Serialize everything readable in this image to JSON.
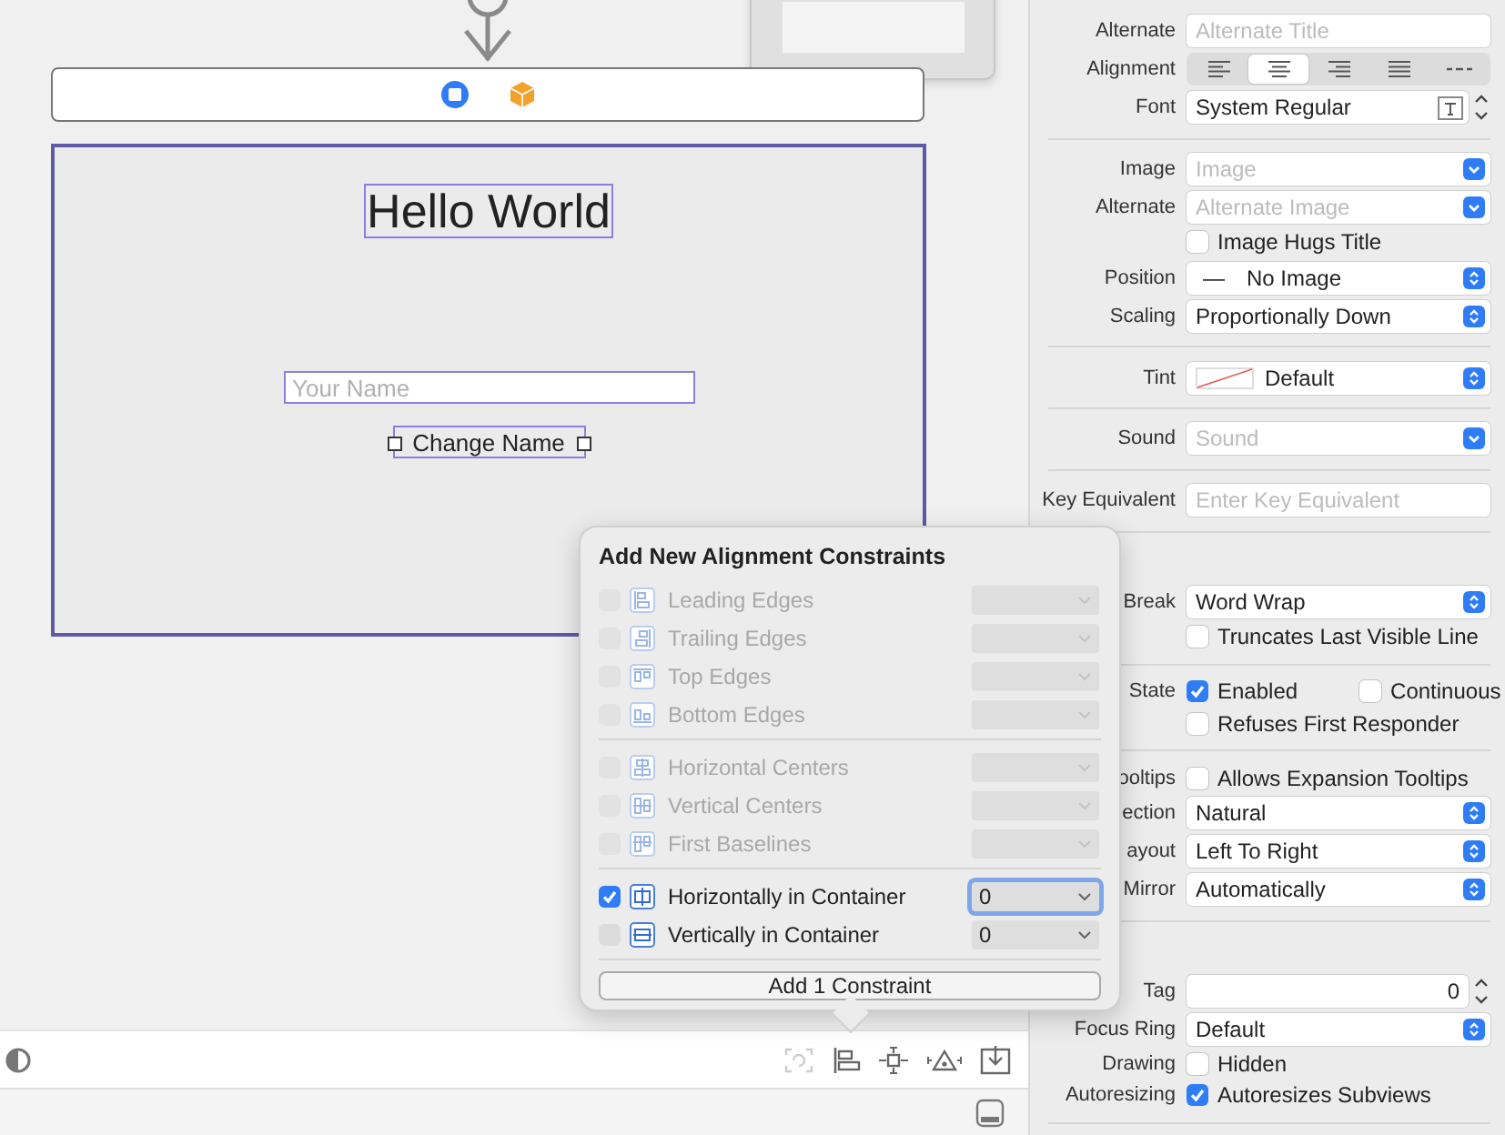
{
  "canvas": {
    "title": "Hello World",
    "text_field": {
      "placeholder": "Your Name"
    },
    "button": "Change Name"
  },
  "popover": {
    "title": "Add New Alignment Constraints",
    "groups": [
      [
        {
          "kind": "leading",
          "label": "Leading Edges",
          "checked": false,
          "disabled": true
        },
        {
          "kind": "trailing",
          "label": "Trailing Edges",
          "checked": false,
          "disabled": true
        },
        {
          "kind": "top",
          "label": "Top Edges",
          "checked": false,
          "disabled": true
        },
        {
          "kind": "bottom",
          "label": "Bottom Edges",
          "checked": false,
          "disabled": true
        }
      ],
      [
        {
          "kind": "hcenter",
          "label": "Horizontal Centers",
          "checked": false,
          "disabled": true
        },
        {
          "kind": "vcenter",
          "label": "Vertical Centers",
          "checked": false,
          "disabled": true
        },
        {
          "kind": "baseline",
          "label": "First Baselines",
          "checked": false,
          "disabled": true
        }
      ],
      [
        {
          "kind": "hcontainer",
          "label": "Horizontally in Container",
          "checked": true,
          "disabled": false,
          "value": "0",
          "focused": true
        },
        {
          "kind": "vcontainer",
          "label": "Vertically in Container",
          "checked": false,
          "disabled": false,
          "value": "0",
          "focused": false
        }
      ]
    ],
    "button": "Add 1 Constraint"
  },
  "inspector": [
    {
      "kind": "field",
      "label": "Alternate",
      "placeholder": "Alternate Title"
    },
    {
      "kind": "segmented",
      "label": "Alignment",
      "segments": [
        {
          "kind": "left",
          "selected": false
        },
        {
          "kind": "center",
          "selected": true
        },
        {
          "kind": "right",
          "selected": false
        },
        {
          "kind": "justify",
          "selected": false
        },
        {
          "kind": "natural",
          "selected": false
        }
      ]
    },
    {
      "kind": "font",
      "label": "Font",
      "value": "System Regular"
    },
    {
      "kind": "divider"
    },
    {
      "kind": "combo",
      "label": "Image",
      "placeholder": "Image"
    },
    {
      "kind": "combo",
      "label": "Alternate",
      "placeholder": "Alternate Image"
    },
    {
      "kind": "checks",
      "checks": [
        {
          "label": "Image Hugs Title",
          "checked": false
        }
      ]
    },
    {
      "kind": "popup",
      "label": "Position",
      "value": "No Image",
      "prefix": "—"
    },
    {
      "kind": "popup",
      "label": "Scaling",
      "value": "Proportionally Down"
    },
    {
      "kind": "divider"
    },
    {
      "kind": "popup",
      "label": "Tint",
      "value": "Default",
      "swatch": true
    },
    {
      "kind": "divider"
    },
    {
      "kind": "combo",
      "label": "Sound",
      "placeholder": "Sound"
    },
    {
      "kind": "divider"
    },
    {
      "kind": "field",
      "label": "Key Equivalent",
      "placeholder": "Enter Key Equivalent"
    },
    {
      "kind": "divider"
    },
    {
      "kind": "spacer"
    },
    {
      "kind": "popup",
      "label": "Break",
      "value": "Word Wrap"
    },
    {
      "kind": "checks",
      "checks": [
        {
          "label": "Truncates Last Visible Line",
          "checked": false
        }
      ]
    },
    {
      "kind": "divider"
    },
    {
      "kind": "checks",
      "label": "State",
      "checks": [
        {
          "label": "Enabled",
          "checked": true
        },
        {
          "label": "Continuous",
          "checked": false
        }
      ]
    },
    {
      "kind": "checks",
      "checks": [
        {
          "label": "Refuses First Responder",
          "checked": false
        }
      ]
    },
    {
      "kind": "divider"
    },
    {
      "kind": "checks",
      "label": "ooltips",
      "checks": [
        {
          "label": "Allows Expansion Tooltips",
          "checked": false
        }
      ]
    },
    {
      "kind": "popup",
      "label": "ection",
      "value": "Natural"
    },
    {
      "kind": "popup",
      "label": "ayout",
      "value": "Left To Right"
    },
    {
      "kind": "popup",
      "label": "Mirror",
      "value": "Automatically"
    },
    {
      "kind": "divider"
    },
    {
      "kind": "spacer"
    },
    {
      "kind": "stepper",
      "label": "Tag",
      "value": "0"
    },
    {
      "kind": "popup",
      "label": "Focus Ring",
      "value": "Default"
    },
    {
      "kind": "checks",
      "label": "Drawing",
      "checks": [
        {
          "label": "Hidden",
          "checked": false
        }
      ]
    },
    {
      "kind": "checks",
      "label": "Autoresizing",
      "checks": [
        {
          "label": "Autoresizes Subviews",
          "checked": true
        }
      ]
    },
    {
      "kind": "divider"
    }
  ]
}
